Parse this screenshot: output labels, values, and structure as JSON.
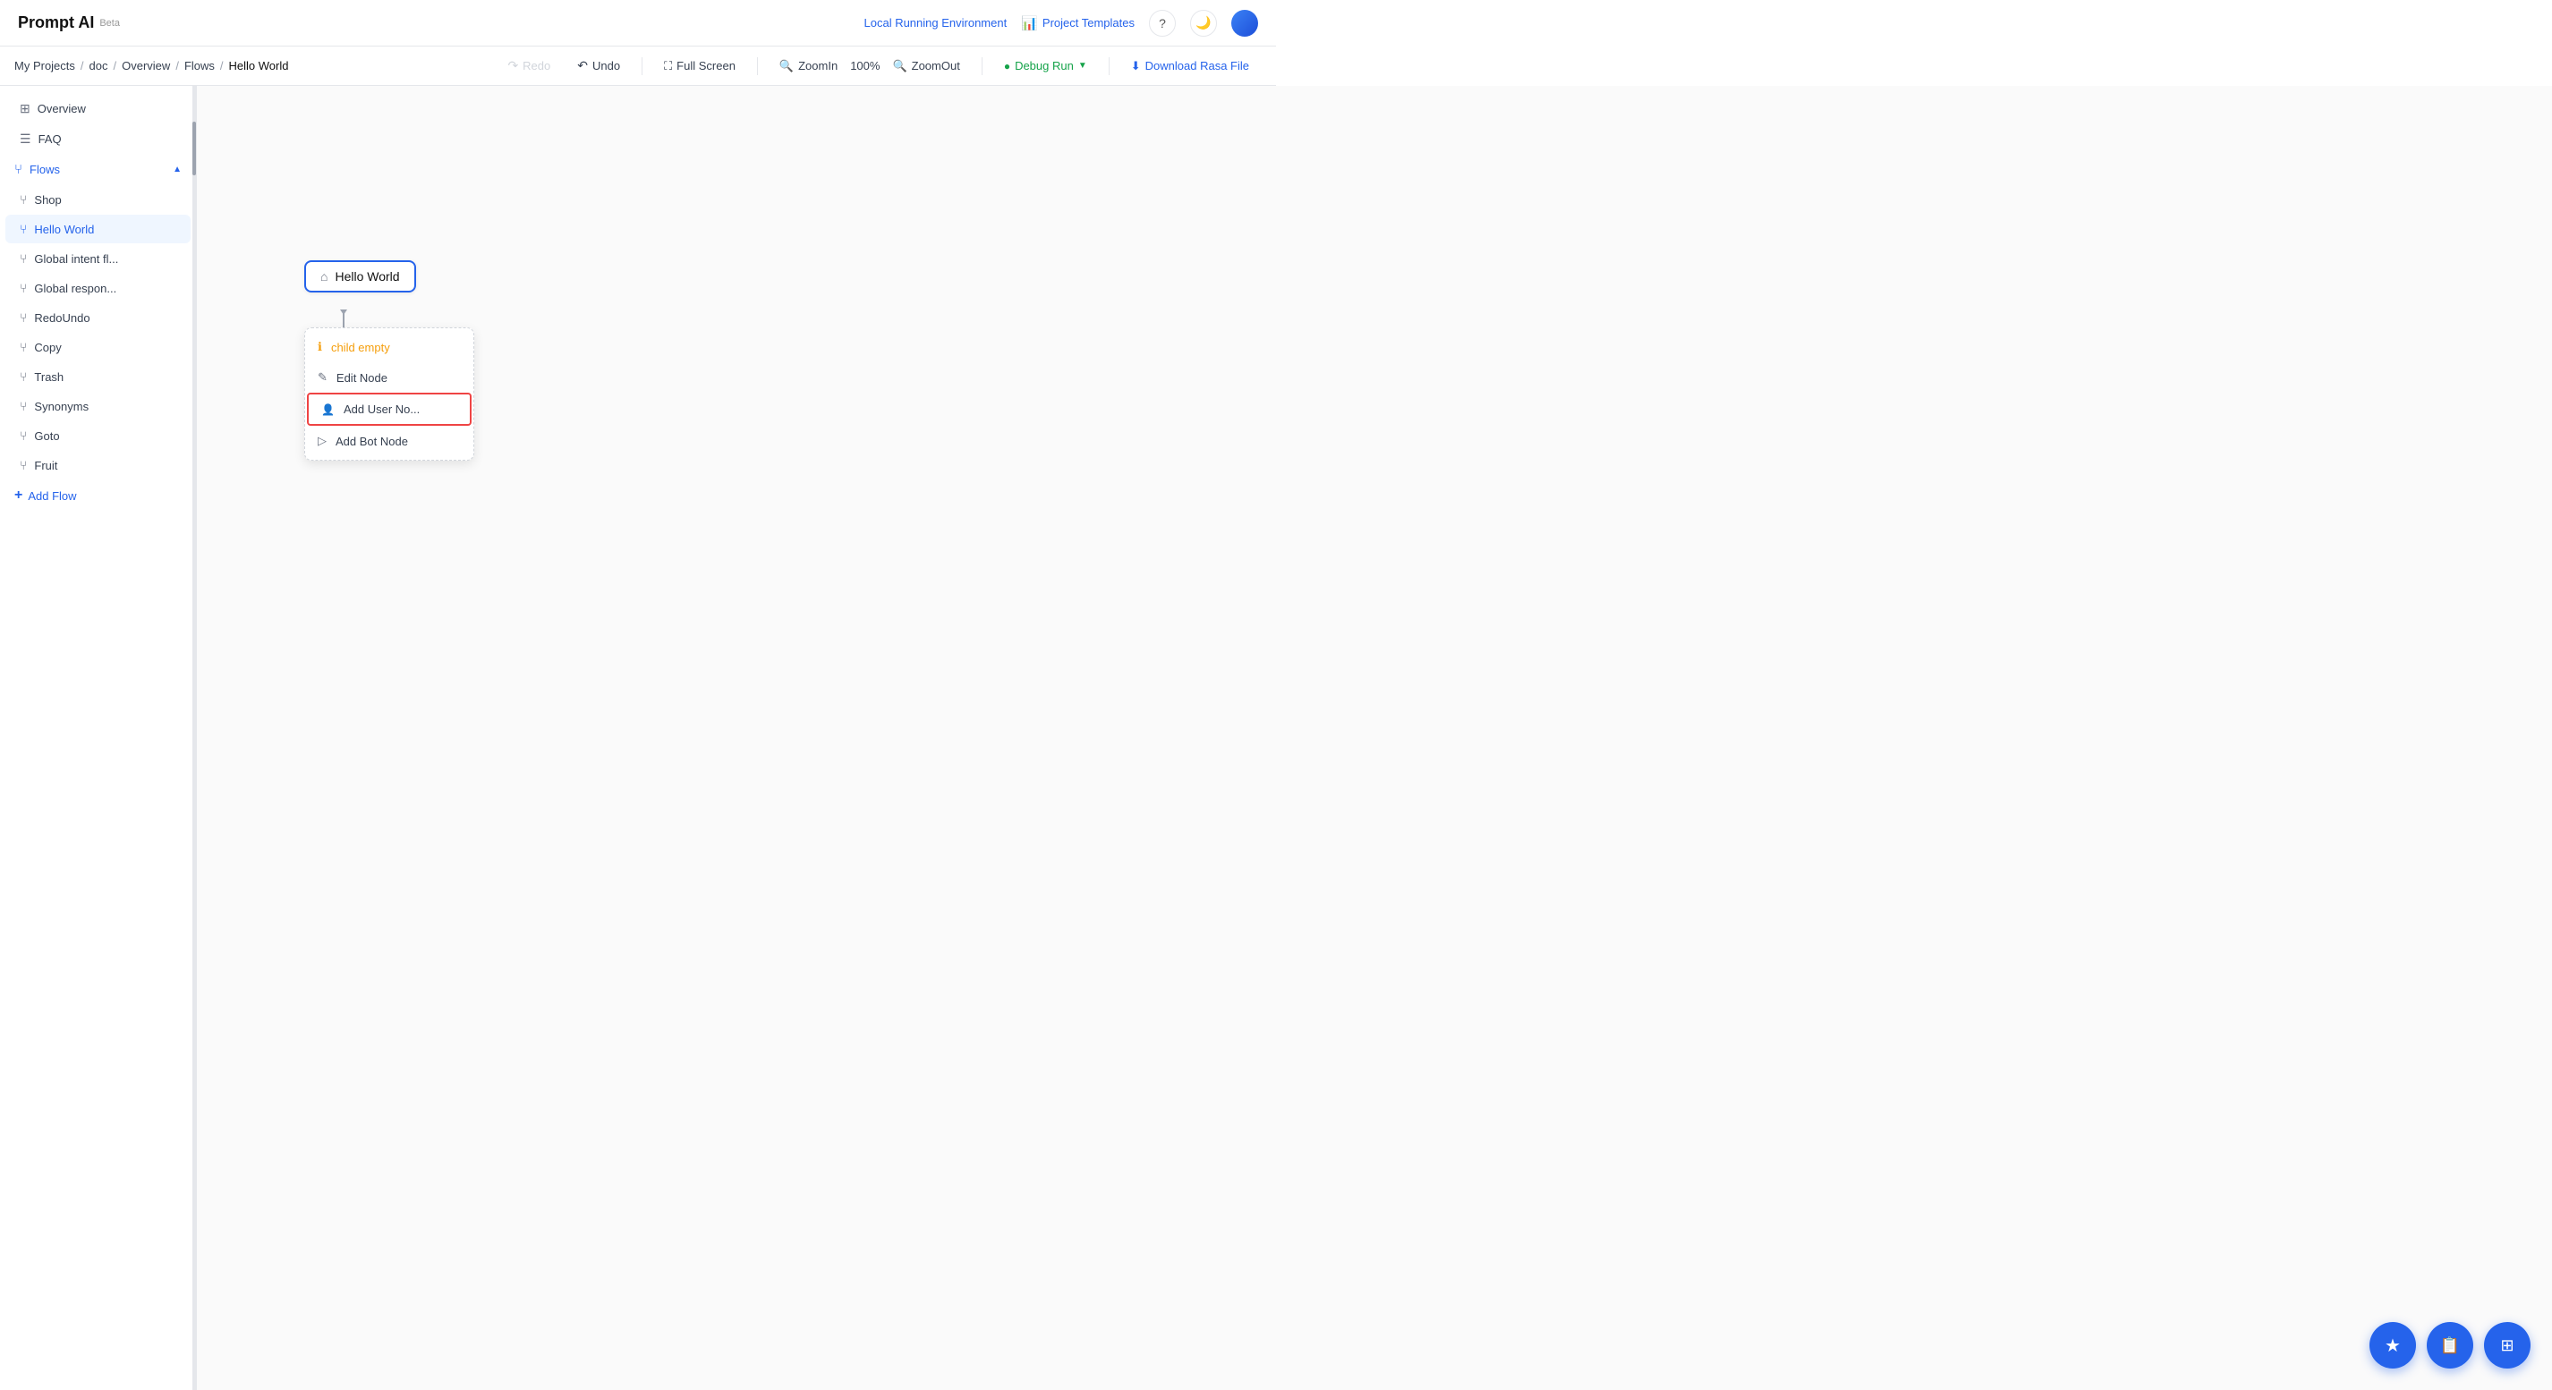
{
  "app": {
    "title": "Prompt AI",
    "beta": "Beta"
  },
  "header": {
    "env_label": "Local Running Environment",
    "templates_label": "Project Templates",
    "help_icon": "?",
    "theme_icon": "🌙"
  },
  "breadcrumb": {
    "items": [
      "My Projects",
      "doc",
      "Overview",
      "Flows",
      "Hello World"
    ]
  },
  "toolbar": {
    "redo_label": "Redo",
    "undo_label": "Undo",
    "fullscreen_label": "Full Screen",
    "zoomin_label": "ZoomIn",
    "zoom_value": "100%",
    "zoomout_label": "ZoomOut",
    "debug_label": "Debug Run",
    "download_label": "Download Rasa File"
  },
  "sidebar": {
    "items": [
      {
        "id": "overview",
        "label": "Overview",
        "icon": "⊞"
      },
      {
        "id": "faq",
        "label": "FAQ",
        "icon": "☰"
      }
    ],
    "flows_section": {
      "label": "Flows",
      "icon": "⑂"
    },
    "flow_items": [
      {
        "id": "shop",
        "label": "Shop",
        "icon": "⑂"
      },
      {
        "id": "hello-world",
        "label": "Hello World",
        "icon": "⑂",
        "active": true
      },
      {
        "id": "global-intent",
        "label": "Global intent fl...",
        "icon": "⑂"
      },
      {
        "id": "global-respon",
        "label": "Global respon...",
        "icon": "⑂"
      },
      {
        "id": "redoundo",
        "label": "RedoUndo",
        "icon": "⑂"
      },
      {
        "id": "copy",
        "label": "Copy",
        "icon": "⑂"
      },
      {
        "id": "trash",
        "label": "Trash",
        "icon": "⑂"
      },
      {
        "id": "synonyms",
        "label": "Synonyms",
        "icon": "⑂"
      },
      {
        "id": "goto",
        "label": "Goto",
        "icon": "⑂"
      },
      {
        "id": "fruit",
        "label": "Fruit",
        "icon": "⑂"
      }
    ],
    "add_flow_label": "Add Flow"
  },
  "canvas": {
    "node": {
      "label": "Hello World",
      "icon": "⌂"
    },
    "context_menu": {
      "items": [
        {
          "id": "child-empty",
          "label": "child empty",
          "icon": "ℹ",
          "type": "warning"
        },
        {
          "id": "edit-node",
          "label": "Edit Node",
          "icon": "✎",
          "type": "normal"
        },
        {
          "id": "add-user-node",
          "label": "Add User No...",
          "icon": "👤",
          "type": "highlighted"
        },
        {
          "id": "add-bot-node",
          "label": "Add Bot Node",
          "icon": "▷",
          "type": "normal"
        }
      ]
    }
  },
  "fab": {
    "star_icon": "★",
    "clipboard_icon": "📋",
    "box_icon": "⊞"
  }
}
